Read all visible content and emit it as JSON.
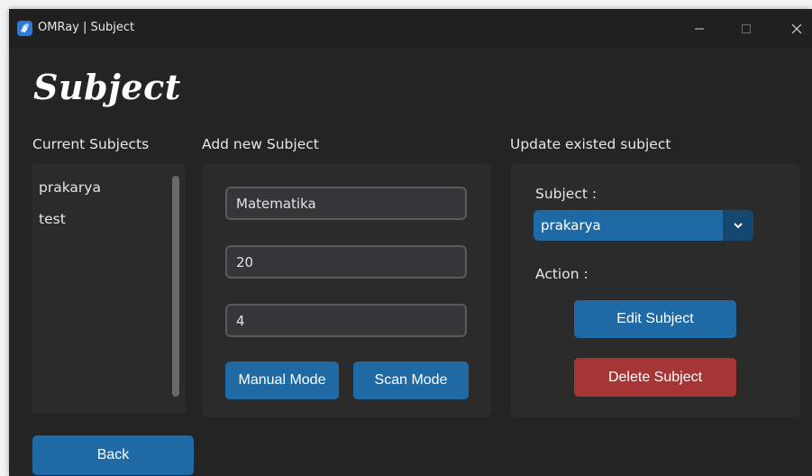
{
  "window": {
    "title": "OMRay | Subject",
    "controls": [
      "minimize-icon",
      "maximize-icon",
      "close-icon"
    ]
  },
  "page": {
    "heading": "Subject"
  },
  "current_subjects": {
    "label": "Current Subjects",
    "items": [
      "prakarya",
      "test"
    ]
  },
  "add_subject": {
    "label": "Add new Subject",
    "fields": [
      {
        "value": "Matematika"
      },
      {
        "value": "20"
      },
      {
        "value": "4"
      }
    ],
    "manual_label": "Manual Mode",
    "scan_label": "Scan Mode"
  },
  "update_subject": {
    "label": "Update existed subject",
    "subject_label": "Subject :",
    "selected": "prakarya",
    "action_label": "Action :",
    "edit_label": "Edit Subject",
    "delete_label": "Delete Subject"
  },
  "back_label": "Back",
  "colors": {
    "accent": "#1f6aa5",
    "danger": "#a63535",
    "background": "#242424",
    "panel": "#2b2b2b"
  }
}
